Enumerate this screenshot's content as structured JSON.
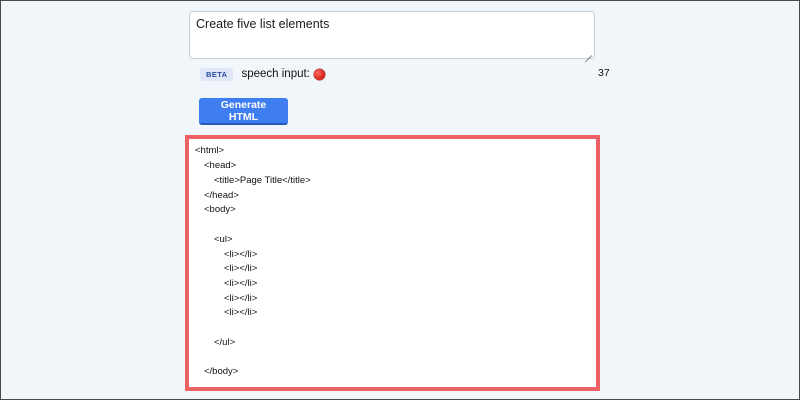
{
  "prompt": {
    "value": "Create five list elements"
  },
  "speech": {
    "badge": "BETA",
    "label": "speech input:",
    "mic_icon": "red-circle-icon",
    "char_count": "37"
  },
  "actions": {
    "generate_label": "Generate HTML"
  },
  "colors": {
    "page_background": "#f1f6fb",
    "button": "#3f7ef0",
    "highlight_border": "#ec6066",
    "mic": "#d0211a"
  },
  "output": {
    "lines": [
      "<html>",
      "<head>",
      "<title>Page Title</title>",
      "</head>",
      "<body>",
      "",
      "<ul>",
      "<li></li>",
      "<li></li>",
      "<li></li>",
      "<li></li>",
      "<li></li>",
      "",
      "</ul>",
      "",
      "</body>"
    ]
  }
}
